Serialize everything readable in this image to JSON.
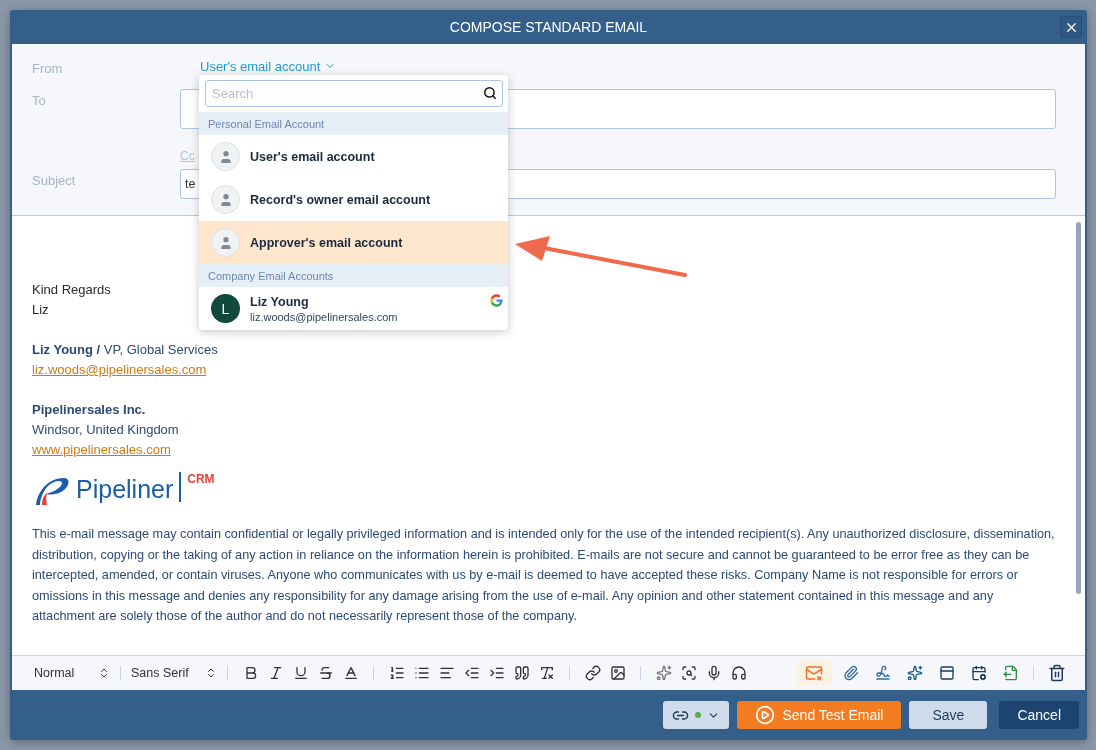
{
  "window": {
    "title": "COMPOSE STANDARD EMAIL"
  },
  "header": {
    "from_label": "From",
    "from_value": "User's email account",
    "to_label": "To",
    "cc_link": "Cc",
    "subject_label": "Subject",
    "subject_value": "te"
  },
  "dropdown": {
    "search_placeholder": "Search",
    "groups": [
      {
        "title": "Personal Email Account",
        "items": [
          {
            "kind": "generic",
            "name": "User's email account",
            "selected": false
          },
          {
            "kind": "generic",
            "name": "Record's owner email account",
            "selected": false
          },
          {
            "kind": "generic",
            "name": "Approver's email account",
            "selected": true
          }
        ]
      },
      {
        "title": "Company Email Accounts",
        "items": [
          {
            "kind": "account",
            "initial": "L",
            "name": "Liz Young",
            "email": "liz.woods@pipelinersales.com",
            "selected": false
          }
        ]
      }
    ]
  },
  "body": {
    "closing": [
      "Kind Regards",
      "Liz"
    ],
    "signature": {
      "name": "Liz Young",
      "separator": "/",
      "title": "VP, Global Services",
      "email": "liz.woods@pipelinersales.com",
      "company": "Pipelinersales Inc.",
      "location": "Windsor, United Kingdom",
      "website": "www.pipelinersales.com"
    },
    "logo": {
      "name": "Pipeliner",
      "tag": "CRM"
    },
    "disclaimer": "This e-mail message may contain confidential or legally privileged information and is intended only for the use of the intended recipient(s). Any unauthorized disclosure, dissemination, distribution, copying or the taking of any action in reliance on the information herein is prohibited. E-mails are not secure and cannot be guaranteed to be error free as they can be intercepted, amended, or contain viruses. Anyone who communicates with us by e-mail is deemed to have accepted these risks. Company Name is not responsible for errors or omissions in this message and denies any responsibility for any damage arising from the use of e-mail. Any opinion and other statement contained in this message and any attachment are solely those of the author and do not necessarily represent those of the company."
  },
  "toolbar": {
    "format": "Normal",
    "font": "Sans Serif",
    "warning_active": true
  },
  "footer": {
    "sync_connected": true,
    "buttons": [
      {
        "kind": "primary",
        "label": "Send Test Email"
      },
      {
        "kind": "secondary",
        "label": "Save"
      },
      {
        "kind": "dark",
        "label": "Cancel"
      }
    ]
  }
}
